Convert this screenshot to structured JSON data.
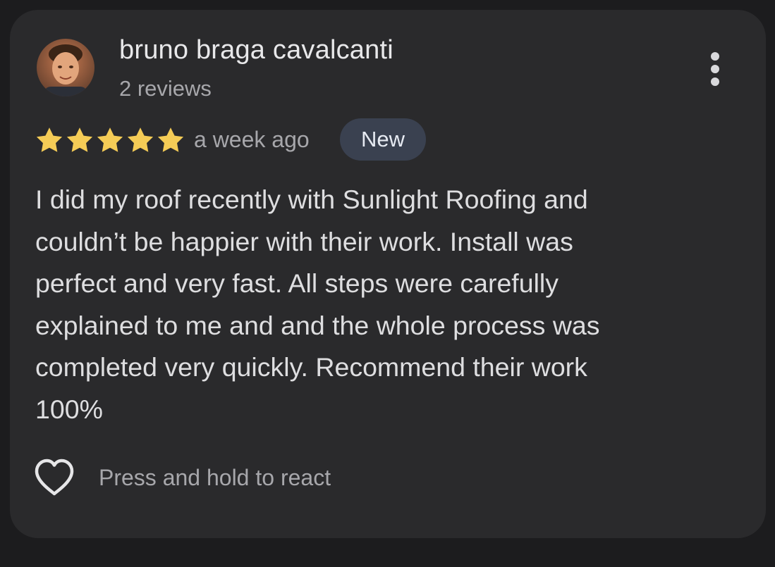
{
  "reviewer": {
    "name": "bruno braga cavalcanti",
    "review_count": "2 reviews",
    "avatar_icon": "profile-photo"
  },
  "review": {
    "rating": 5,
    "rating_max": 5,
    "date": "a week ago",
    "badge": "New",
    "text": "I did my roof recently with Sunlight Roofing and\ncouldn’t be happier with their work. Install was\nperfect and very fast. All steps were carefully\nexplained to me and and the whole process was\ncompleted very quickly. Recommend their work\n100%"
  },
  "actions": {
    "react_label": "Press and hold to react",
    "react_icon": "heart-outline-icon",
    "menu_icon": "more-vertical-icon"
  },
  "colors": {
    "background": "#1c1c1e",
    "card": "#2a2a2c",
    "star": "#f5cc56",
    "badge_bg": "#3a4150",
    "primary_text": "#e8e8ea",
    "secondary_text": "#a7a7ab"
  }
}
